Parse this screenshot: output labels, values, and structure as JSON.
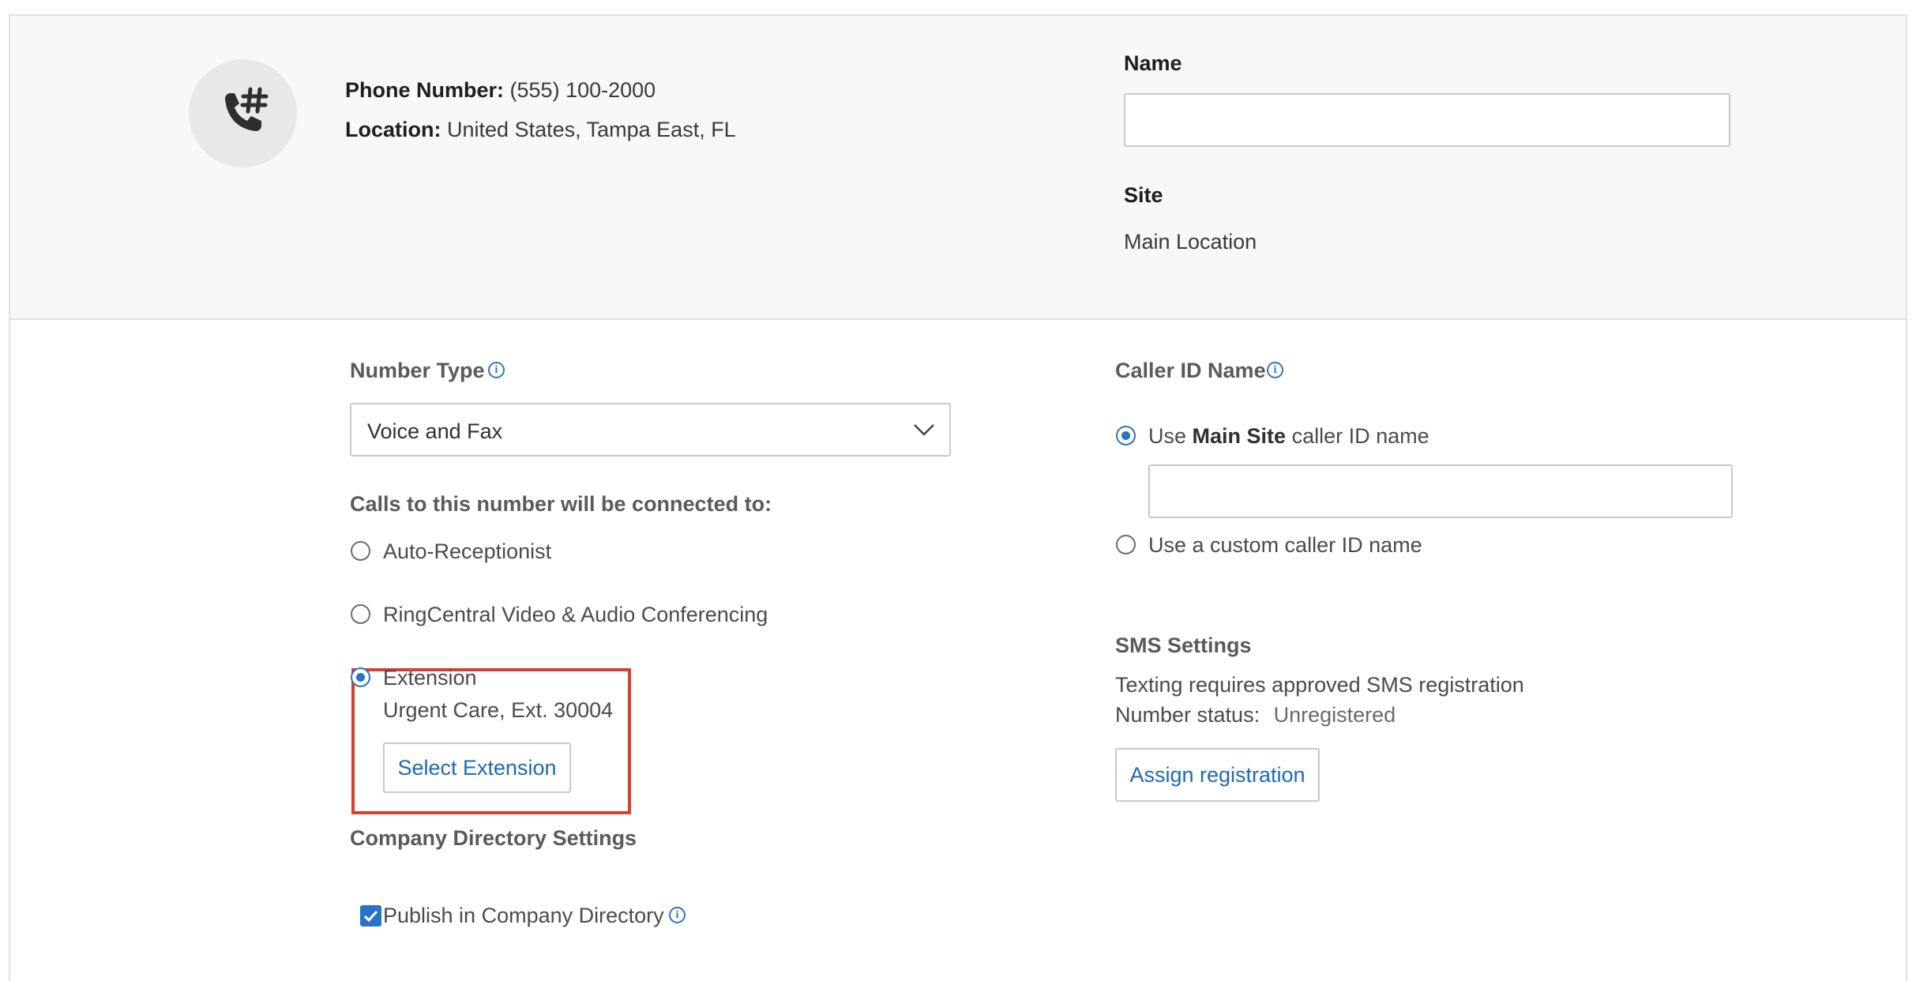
{
  "header": {
    "phone_label": "Phone Number:",
    "phone_value": "(555) 100-2000",
    "location_label": "Location:",
    "location_value": "United States, Tampa East, FL",
    "avatar_icon": "phone-hash-icon",
    "name_label": "Name",
    "name_value": "",
    "site_label": "Site",
    "site_value": "Main Location"
  },
  "number_type": {
    "label": "Number Type",
    "info_icon": "info-icon",
    "selected": "Voice and Fax"
  },
  "connected": {
    "label": "Calls to this number will be connected to:",
    "options": [
      {
        "label": "Auto-Receptionist",
        "selected": false
      },
      {
        "label": "RingCentral Video & Audio Conferencing",
        "selected": false
      },
      {
        "label": "Extension",
        "selected": true
      }
    ],
    "extension_detail": "Urgent Care, Ext. 30004",
    "select_button": "Select Extension"
  },
  "directory": {
    "label": "Company Directory Settings",
    "publish_label": "Publish in Company Directory",
    "publish_checked": true
  },
  "caller_id": {
    "label": "Caller ID Name",
    "option1_prefix": "Use ",
    "option1_bold": "Main Site",
    "option1_suffix": " caller ID name",
    "option1_selected": true,
    "option1_value": "",
    "option2_label": "Use a custom caller ID name",
    "option2_selected": false
  },
  "sms": {
    "label": "SMS Settings",
    "description": "Texting requires approved SMS registration",
    "status_label": "Number status:",
    "status_value": "Unregistered",
    "button": "Assign registration"
  },
  "colors": {
    "accent": "#2a72c9",
    "highlight": "#d9402a",
    "header_bg": "#f8f8f8"
  }
}
